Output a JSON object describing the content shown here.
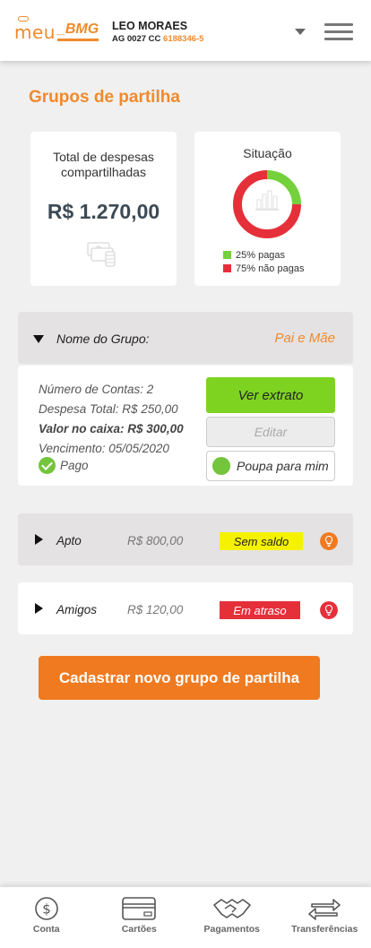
{
  "header": {
    "logo_text_1": "meu",
    "logo_text_2": "_BMG",
    "user_name": "LEO MORAES",
    "account_prefix": "AG 0027 CC",
    "account_number": "6188346-5"
  },
  "page": {
    "title": "Grupos de partilha"
  },
  "summary": {
    "total_label": "Total de despesas compartilhadas",
    "total_amount": "R$ 1.270,00",
    "status_label": "Situação",
    "chart_data": {
      "type": "pie",
      "slices": [
        {
          "label": "25% pagas",
          "value": 25,
          "color": "#74d13c"
        },
        {
          "label": "75% não pagas",
          "value": 75,
          "color": "#e5303a"
        }
      ]
    }
  },
  "group_open": {
    "label": "Nome do Grupo:",
    "name": "Pai e Mãe",
    "line1": "Número de Contas: 2",
    "line2": "Despesa Total: R$ 250,00",
    "line3": "Valor no caixa: R$ 300,00",
    "line4": "Vencimento: 05/05/2020",
    "status": "Pago",
    "btn_extrato": "Ver extrato",
    "btn_editar": "Editar",
    "btn_poupa": "Poupa para mim"
  },
  "groups": [
    {
      "name": "Apto",
      "amount": "R$ 800,00",
      "badge": "Sem saldo",
      "badge_color": "#f5f200",
      "bulb_color": "#f07a20"
    },
    {
      "name": "Amigos",
      "amount": "R$ 120,00",
      "badge": "Em atraso",
      "badge_color": "#e5303a",
      "bulb_color": "#e5303a"
    }
  ],
  "cta": {
    "label": "Cadastrar novo grupo de partilha"
  },
  "tabs": [
    {
      "label": "Conta",
      "icon": "dollar-circle-icon"
    },
    {
      "label": "Cartões",
      "icon": "card-icon"
    },
    {
      "label": "Pagamentos",
      "icon": "handshake-icon"
    },
    {
      "label": "Transferências",
      "icon": "arrows-swap-icon"
    }
  ]
}
